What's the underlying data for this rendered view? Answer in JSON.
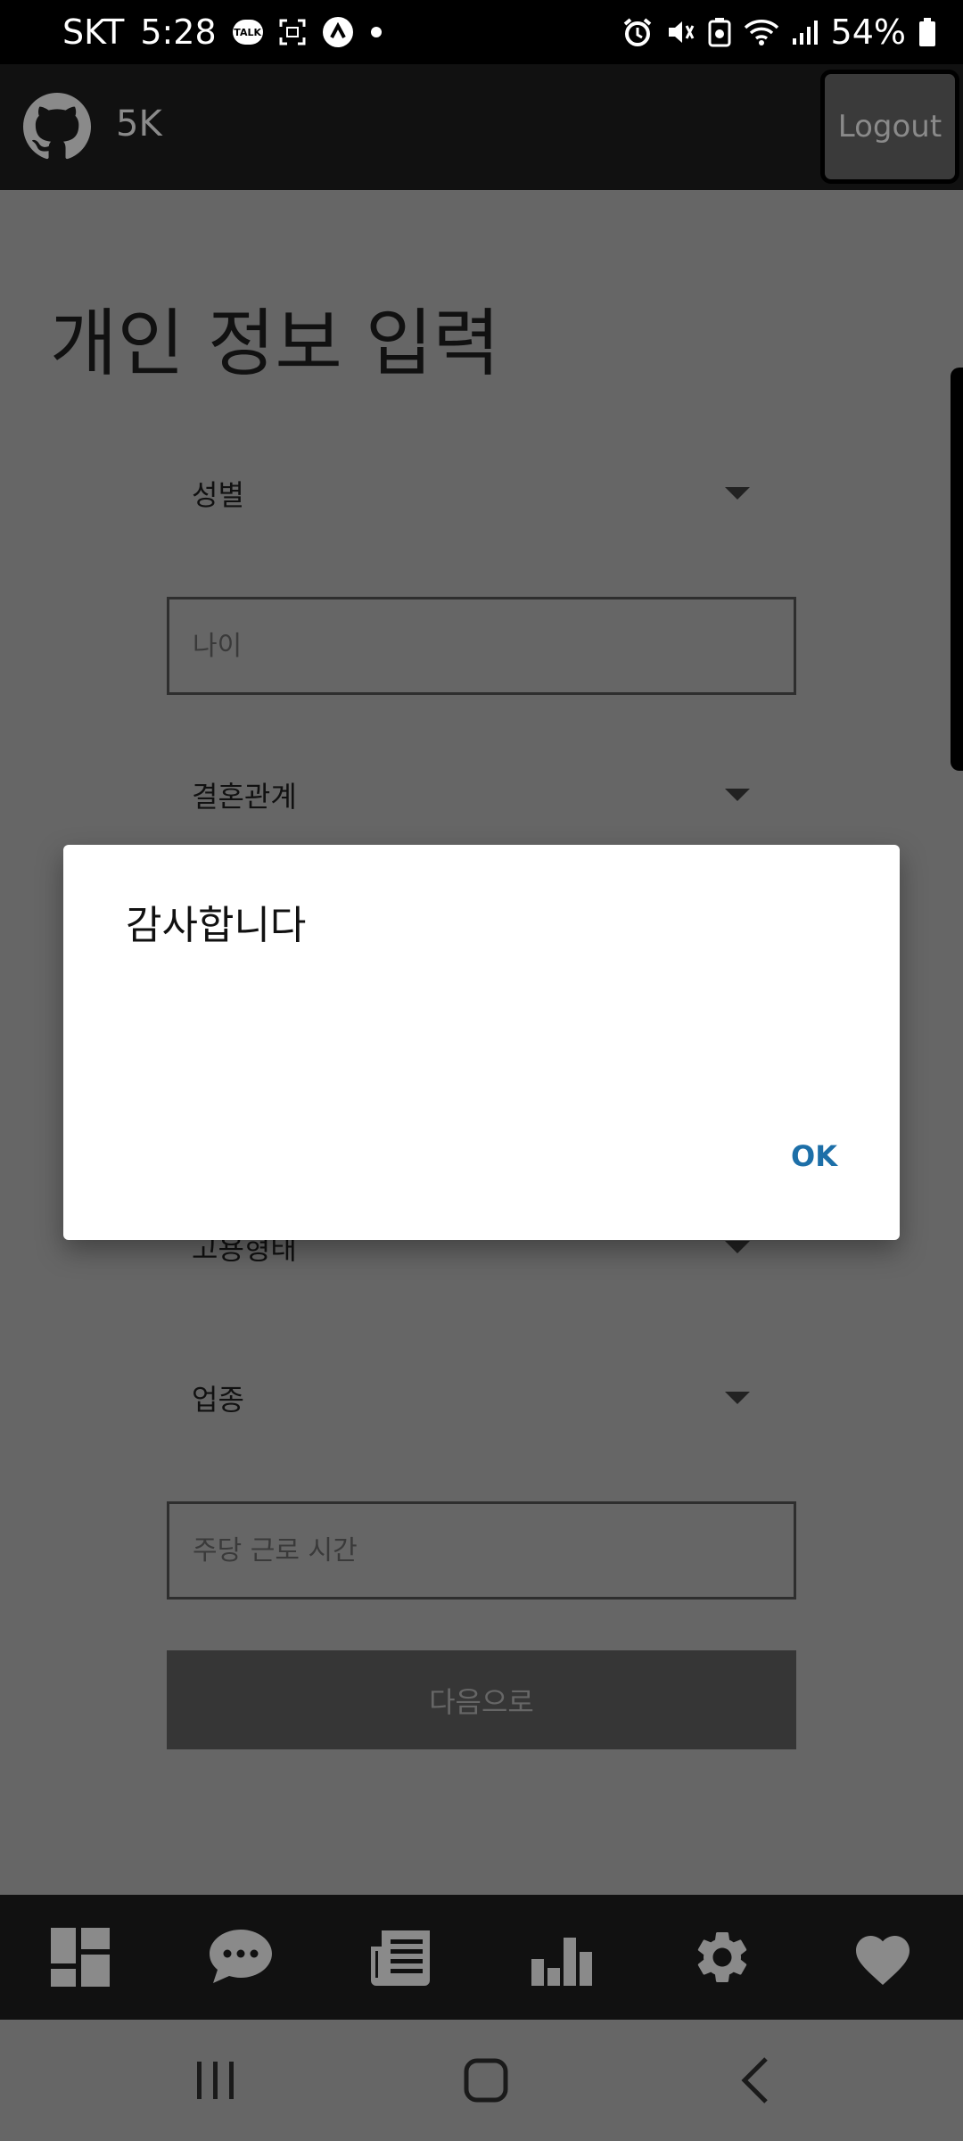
{
  "status_bar": {
    "carrier": "SKT",
    "time": "5:28",
    "talk_badge": "TALK",
    "battery": "54%"
  },
  "header": {
    "brand": "5K",
    "logout_label": "Logout"
  },
  "page": {
    "title": "개인 정보 입력",
    "fields": {
      "gender_label": "성별",
      "age_placeholder": "나이",
      "marriage_label": "결혼관계",
      "employment_label": "고용형태",
      "industry_label": "업종",
      "hours_placeholder": "주당 근로 시간"
    },
    "next_label": "다음으로"
  },
  "dialog": {
    "message": "감사합니다",
    "ok_label": "OK"
  },
  "tabbar": {
    "icons": [
      "dashboard-icon",
      "chat-icon",
      "article-icon",
      "bar-chart-icon",
      "gear-icon",
      "heart-icon"
    ]
  },
  "colors": {
    "overlay_background": "#666666",
    "header_background": "#111111",
    "dialog_background": "#ffffff",
    "accent": "#1d6fa8"
  }
}
